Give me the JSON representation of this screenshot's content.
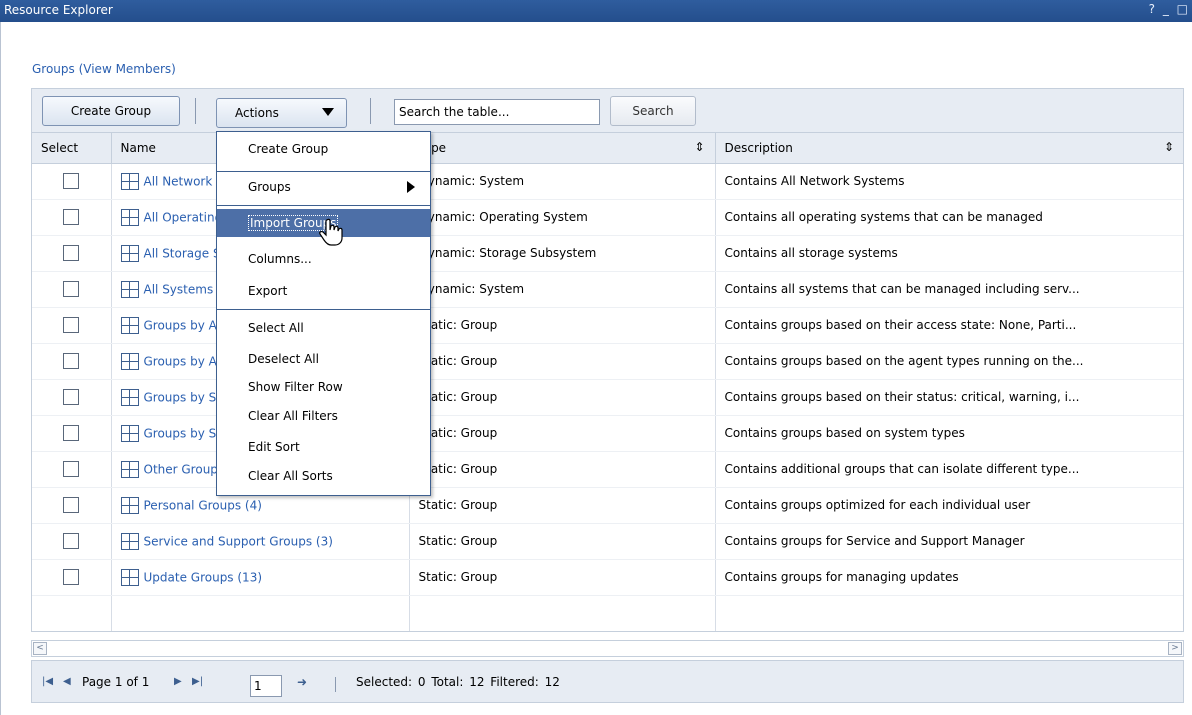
{
  "window": {
    "title": "Resource Explorer",
    "controls": "? _ □"
  },
  "section_link": "Groups (View Members)",
  "toolbar": {
    "create_label": "Create Group",
    "actions_label": "Actions",
    "search_placeholder": "Search the table...",
    "search_button": "Search"
  },
  "table": {
    "columns": [
      "Select",
      "Name",
      "Type",
      "Description"
    ],
    "rows": [
      {
        "name": "All Network Systems (6)",
        "type": "Dynamic: System",
        "description": "Contains All Network Systems"
      },
      {
        "name": "All Operating Systems (24)",
        "type": "Dynamic: Operating System",
        "description": "Contains all operating systems that can be managed"
      },
      {
        "name": "All Storage Systems (2)",
        "type": "Dynamic: Storage Subsystem",
        "description": "Contains all storage systems"
      },
      {
        "name": "All Systems (60)",
        "type": "Dynamic: System",
        "description": "Contains all systems that can be managed including serv..."
      },
      {
        "name": "Groups by Access (5)",
        "type": "Static: Group",
        "description": "Contains groups based on their access state: None, Parti..."
      },
      {
        "name": "Groups by Agent (5)",
        "type": "Static: Group",
        "description": "Contains groups based on the agent types running on the..."
      },
      {
        "name": "Groups by Status (4)",
        "type": "Static: Group",
        "description": "Contains groups based on their status: critical, warning, i..."
      },
      {
        "name": "Groups by System Type (10)",
        "type": "Static: Group",
        "description": "Contains groups based on system types"
      },
      {
        "name": "Other Groups by System Type (8)",
        "type": "Static: Group",
        "description": "Contains additional groups that can isolate different type..."
      },
      {
        "name": "Personal Groups (4)",
        "type": "Static: Group",
        "description": "Contains groups optimized for each individual user"
      },
      {
        "name": "Service and Support Groups (3)",
        "type": "Static: Group",
        "description": "Contains groups for Service and Support Manager"
      },
      {
        "name": "Update Groups (13)",
        "type": "Static: Group",
        "description": "Contains groups for managing updates"
      }
    ]
  },
  "pager": {
    "page_label": "Page 1 of 1",
    "page_value": "1",
    "stats": "Selected: 0   Total: 12   Filtered: 12"
  },
  "actions_menu": {
    "items": [
      {
        "label": "Create Group"
      },
      {
        "label": "Groups",
        "submenu": true
      },
      {
        "label": "Import Groups",
        "highlighted": true
      },
      {
        "label": "Columns..."
      },
      {
        "label": "Export"
      },
      {
        "label": "Select All"
      },
      {
        "label": "Deselect All"
      },
      {
        "label": "Show Filter Row"
      },
      {
        "label": "Clear All Filters"
      },
      {
        "label": "Edit Sort"
      },
      {
        "label": "Clear All Sorts"
      }
    ]
  },
  "colors": {
    "titlebar": "#2f5d9e",
    "link": "#2a5fb0",
    "menu_highlight": "#4d6fa7",
    "toolbar_bg": "#e7ecf3"
  },
  "icons": {
    "group": "grid-icon",
    "sort": "sort-icon",
    "hand_cursor": "hand-pointer-icon"
  }
}
